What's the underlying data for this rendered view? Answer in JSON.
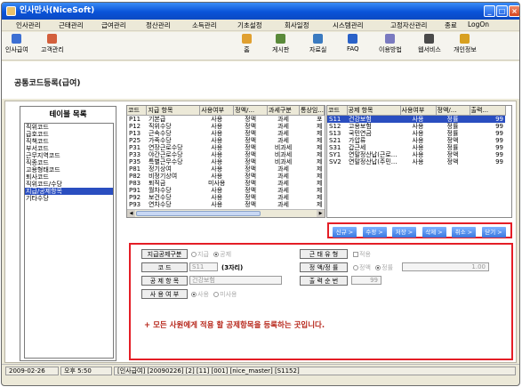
{
  "window": {
    "title": "인사만사(NiceSoft)"
  },
  "menubar": {
    "items": [
      "인사관리",
      "근태관리",
      "급여관리",
      "정산관리",
      "소득관리",
      "기초설정",
      "회사일정",
      "시스템관리",
      "고정자산관리",
      "종료",
      "LogOn"
    ]
  },
  "toolbar": {
    "left": [
      {
        "label": "인사급여",
        "icon": "person-card-icon",
        "color": "#3c6fd3"
      },
      {
        "label": "고객관리",
        "icon": "customer-icon",
        "color": "#d35f3c"
      }
    ],
    "right": [
      {
        "label": "홈",
        "icon": "home-icon",
        "color": "#e0a030"
      },
      {
        "label": "게시판",
        "icon": "board-icon",
        "color": "#5a8a3a"
      },
      {
        "label": "자료실",
        "icon": "archive-icon",
        "color": "#3a7ac0"
      },
      {
        "label": "FAQ",
        "icon": "faq-icon",
        "color": "#2a62c8"
      },
      {
        "label": "이용방법",
        "icon": "guide-icon",
        "color": "#7a7ac0"
      },
      {
        "label": "웹서비스",
        "icon": "web-service-icon",
        "color": "#4a4a4a"
      },
      {
        "label": "개인정보",
        "icon": "privacy-icon",
        "color": "#d8a020"
      }
    ]
  },
  "page": {
    "title": "공통코드등록(급여)"
  },
  "left_panel": {
    "title": "테이블 목록",
    "items": [
      "직위코드",
      "급호코드",
      "직책코드",
      "부서코드",
      "근무지역코드",
      "직종코드",
      "고용형태코드",
      "퇴사코드",
      "직위코드/수당",
      "지급/공제항목",
      "기타수당"
    ],
    "selected_index": 9
  },
  "grid1": {
    "headers": [
      "코드",
      "지급 항목",
      "사용여부",
      "정액/...",
      "과세구분",
      "통상임..."
    ],
    "rows": [
      [
        "P11",
        "기본급",
        "사용",
        "정액",
        "과세",
        "포"
      ],
      [
        "P12",
        "직위수당",
        "사용",
        "정액",
        "과세",
        "제"
      ],
      [
        "P13",
        "근속수당",
        "사용",
        "정액",
        "과세",
        "제"
      ],
      [
        "P25",
        "가족수당",
        "사용",
        "정액",
        "과세",
        "제"
      ],
      [
        "P31",
        "연장근로수당",
        "사용",
        "정액",
        "비과세",
        "제"
      ],
      [
        "P33",
        "야간근로수당",
        "사용",
        "정액",
        "비과세",
        "제"
      ],
      [
        "P35",
        "특별근무수당",
        "사용",
        "정액",
        "비과세",
        "제"
      ],
      [
        "P81",
        "정기상여",
        "사용",
        "정액",
        "과세",
        "제"
      ],
      [
        "P82",
        "비정기상여",
        "사용",
        "정액",
        "과세",
        "제"
      ],
      [
        "P83",
        "퇴직금",
        "미사용",
        "정액",
        "과세",
        "제"
      ],
      [
        "P91",
        "월차수당",
        "사용",
        "정액",
        "과세",
        "제"
      ],
      [
        "P92",
        "보건수당",
        "사용",
        "정액",
        "과세",
        "제"
      ],
      [
        "P93",
        "연차수당",
        "사용",
        "정액",
        "과세",
        "제"
      ]
    ]
  },
  "grid2": {
    "headers": [
      "코드",
      "공제 항목",
      "사용여부",
      "정액/...",
      "출력..."
    ],
    "rows": [
      [
        "S11",
        "건강보험",
        "사용",
        "정률",
        "99"
      ],
      [
        "S12",
        "고용보험",
        "사용",
        "정률",
        "99"
      ],
      [
        "S13",
        "국민연금",
        "사용",
        "정률",
        "99"
      ],
      [
        "S21",
        "가압류",
        "사용",
        "정액",
        "99"
      ],
      [
        "S31",
        "갑근세",
        "사용",
        "정률",
        "99"
      ],
      [
        "SY1",
        "연말정산납(근로...",
        "사용",
        "정액",
        "99"
      ],
      [
        "SV2",
        "연말정산납(주민...",
        "사용",
        "정액",
        "99"
      ]
    ],
    "selected_index": 0
  },
  "actions": [
    "신규 >",
    "수정 >",
    "저장 >",
    "삭제 >",
    "취소 >",
    "닫기 >"
  ],
  "form": {
    "pay_deduct_label": "지급공제구분",
    "pay_option": "지급",
    "deduct_option": "공제",
    "code_label": "코 드",
    "code_value": "S11",
    "code_hint": "(3자리)",
    "item_label": "공 제 항 목",
    "item_value": "건강보험",
    "use_label": "사 용 여 부",
    "use_option": "사용",
    "unuse_option": "미사용",
    "work_type_label": "근 태 유 형",
    "work_type_check": "적용",
    "fixed_rate_label": "정 액/정 률",
    "fixed_option": "정액",
    "rate_option": "정률",
    "rate_value": "1.00",
    "order_label": "출 력 순 번",
    "order_value": "99",
    "notice": "+ 모든 사원에게 적용 할 공제항목을 등록하는 곳입니다."
  },
  "statusbar": {
    "date": "2009-02-26",
    "time": "오후 5:50",
    "info": "[인사급여] [20090226] [2] [11] [001] [nice_master] [S1152]"
  }
}
